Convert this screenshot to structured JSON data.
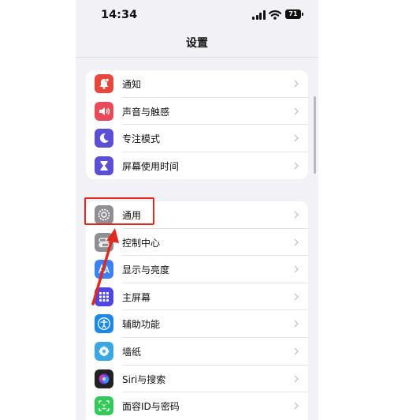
{
  "status_bar": {
    "time": "14:34",
    "battery": "71"
  },
  "nav": {
    "title": "设置"
  },
  "groups": [
    {
      "items": [
        {
          "label": "通知",
          "icon": "bell-icon",
          "color": "#e8483a"
        },
        {
          "label": "声音与触感",
          "icon": "speaker-icon",
          "color": "#e84a5a"
        },
        {
          "label": "专注模式",
          "icon": "moon-icon",
          "color": "#5b4fd6"
        },
        {
          "label": "屏幕使用时间",
          "icon": "hourglass-icon",
          "color": "#5b4fd6"
        }
      ]
    },
    {
      "items": [
        {
          "label": "通用",
          "icon": "gear-icon",
          "color": "#8e8e93"
        },
        {
          "label": "控制中心",
          "icon": "toggles-icon",
          "color": "#8e8e93"
        },
        {
          "label": "显示与亮度",
          "icon": "aa-icon",
          "color": "#3b82f6"
        },
        {
          "label": "主屏幕",
          "icon": "grid-icon",
          "color": "#4f46e5"
        },
        {
          "label": "辅助功能",
          "icon": "accessibility-icon",
          "color": "#1e88e5"
        },
        {
          "label": "墙纸",
          "icon": "flower-icon",
          "color": "#3aa7e0"
        },
        {
          "label": "Siri与搜索",
          "icon": "siri-icon",
          "color": "#222222"
        },
        {
          "label": "面容ID与密码",
          "icon": "faceid-icon",
          "color": "#34c759"
        }
      ]
    }
  ],
  "annotation": {
    "color": "#e02a20",
    "target": "通用"
  }
}
